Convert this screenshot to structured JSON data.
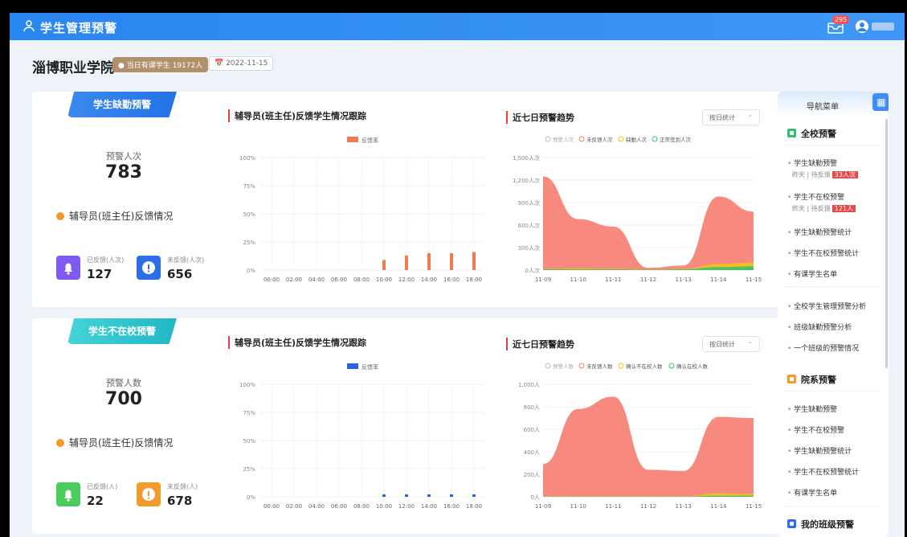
{
  "topbar": {
    "title": "学生管理预警",
    "badge": "295"
  },
  "header": {
    "school": "淄博职业学院",
    "enrolled": "当日有课学生 19172人",
    "date": "2022-11-15"
  },
  "panel1": {
    "tab": "学生缺勤预警",
    "count_label": "预警人次",
    "count": "783",
    "feedback_title": "辅导员(班主任)反馈情况",
    "stat1_label": "已反馈(人次)",
    "stat1_value": "127",
    "stat2_label": "未反馈(人次)",
    "stat2_value": "656",
    "bar_title": "辅导员(班主任)反馈学生情况跟踪",
    "bar_legend": "反馈率",
    "trend_title": "近七日预警趋势",
    "select": "按日统计",
    "trend_legend": [
      "预警人次",
      "未反馈人次",
      "缺勤人次",
      "正常签到人次"
    ]
  },
  "panel2": {
    "tab": "学生不在校预警",
    "count_label": "预警人数",
    "count": "700",
    "feedback_title": "辅导员(班主任)反馈情况",
    "stat1_label": "已反馈(人)",
    "stat1_value": "22",
    "stat2_label": "未反馈(人)",
    "stat2_value": "678",
    "bar_title": "辅导员(班主任)反馈学生情况跟踪",
    "bar_legend": "反馈率",
    "trend_title": "近七日预警趋势",
    "select": "按日统计",
    "trend_legend": [
      "预警人数",
      "未反馈人数",
      "确认不在校人数",
      "确认在校人数"
    ]
  },
  "nav": {
    "title": "导航菜单",
    "group1": "全校预警",
    "g1_items": [
      "学生缺勤预警",
      "学生不在校预警",
      "学生缺勤预警统计",
      "学生不在校预警统计",
      "有课学生名单"
    ],
    "g1_sub1": {
      "text": "昨天 | 待反馈",
      "badge": "33人次"
    },
    "g1_sub2": {
      "text": "昨天 | 待反馈",
      "badge": "121人"
    },
    "analysis": [
      "全校学生管理预警分析",
      "班级缺勤预警分析",
      "一个班级的预警情况"
    ],
    "group2": "院系预警",
    "g2_items": [
      "学生缺勤预警",
      "学生不在校预警",
      "学生缺勤预警统计",
      "学生不在校预警统计",
      "有课学生名单"
    ],
    "group3": "我的班级预警"
  },
  "chart_data": [
    {
      "type": "bar",
      "title": "辅导员(班主任)反馈学生情况跟踪",
      "categories": [
        "00:00",
        "02:00",
        "04:00",
        "06:00",
        "08:00",
        "10:00",
        "12:00",
        "14:00",
        "16:00",
        "18:00"
      ],
      "series": [
        {
          "name": "反馈率",
          "values": [
            0,
            0,
            0,
            0,
            0,
            9,
            13,
            15,
            15,
            16
          ]
        }
      ],
      "ylim": [
        0,
        100
      ],
      "yticks": [
        "0%",
        "25%",
        "50%",
        "75%",
        "100%"
      ],
      "color": "#f07b4f"
    },
    {
      "type": "area",
      "title": "近七日预警趋势",
      "categories": [
        "11-09",
        "11-10",
        "11-11",
        "11-12",
        "11-13",
        "11-14",
        "11-15"
      ],
      "ylim": [
        0,
        1500
      ],
      "yticks": [
        "0人次",
        "300人次",
        "600人次",
        "900人次",
        "1,200人次",
        "1,500人次"
      ],
      "series": [
        {
          "name": "未反馈人次",
          "values": [
            1250,
            680,
            580,
            30,
            60,
            980,
            780
          ],
          "color": "#f67f73"
        },
        {
          "name": "缺勤人次",
          "values": [
            15,
            20,
            15,
            10,
            15,
            80,
            100
          ],
          "color": "#f5c018"
        },
        {
          "name": "正常签到人次",
          "values": [
            10,
            10,
            10,
            5,
            10,
            40,
            50
          ],
          "color": "#3cc26b"
        }
      ]
    },
    {
      "type": "bar",
      "title": "辅导员(班主任)反馈学生情况跟踪",
      "categories": [
        "00:00",
        "02:00",
        "04:00",
        "06:00",
        "08:00",
        "10:00",
        "12:00",
        "14:00",
        "16:00",
        "18:00"
      ],
      "series": [
        {
          "name": "反馈率",
          "values": [
            0,
            0,
            0,
            0,
            0,
            0.5,
            1,
            1,
            1,
            1
          ]
        }
      ],
      "ylim": [
        0,
        100
      ],
      "yticks": [
        "0%",
        "25%",
        "50%",
        "75%",
        "100%"
      ],
      "color": "#2a62e0"
    },
    {
      "type": "area",
      "title": "近七日预警趋势",
      "categories": [
        "11-09",
        "11-10",
        "11-11",
        "11-12",
        "11-13",
        "11-14",
        "11-15"
      ],
      "ylim": [
        0,
        1000
      ],
      "yticks": [
        "0人",
        "200人",
        "400人",
        "600人",
        "800人",
        "1,000人"
      ],
      "series": [
        {
          "name": "未反馈人数",
          "values": [
            290,
            780,
            890,
            240,
            230,
            710,
            700
          ],
          "color": "#f67f73"
        },
        {
          "name": "确认不在校人数",
          "values": [
            5,
            5,
            5,
            5,
            5,
            30,
            25
          ],
          "color": "#f5c018"
        },
        {
          "name": "确认在校人数",
          "values": [
            2,
            2,
            2,
            2,
            2,
            10,
            10
          ],
          "color": "#3cc26b"
        }
      ]
    }
  ],
  "colors": {
    "primary": "#2a86ef",
    "warn": "#f0992e",
    "danger": "#e74848"
  }
}
